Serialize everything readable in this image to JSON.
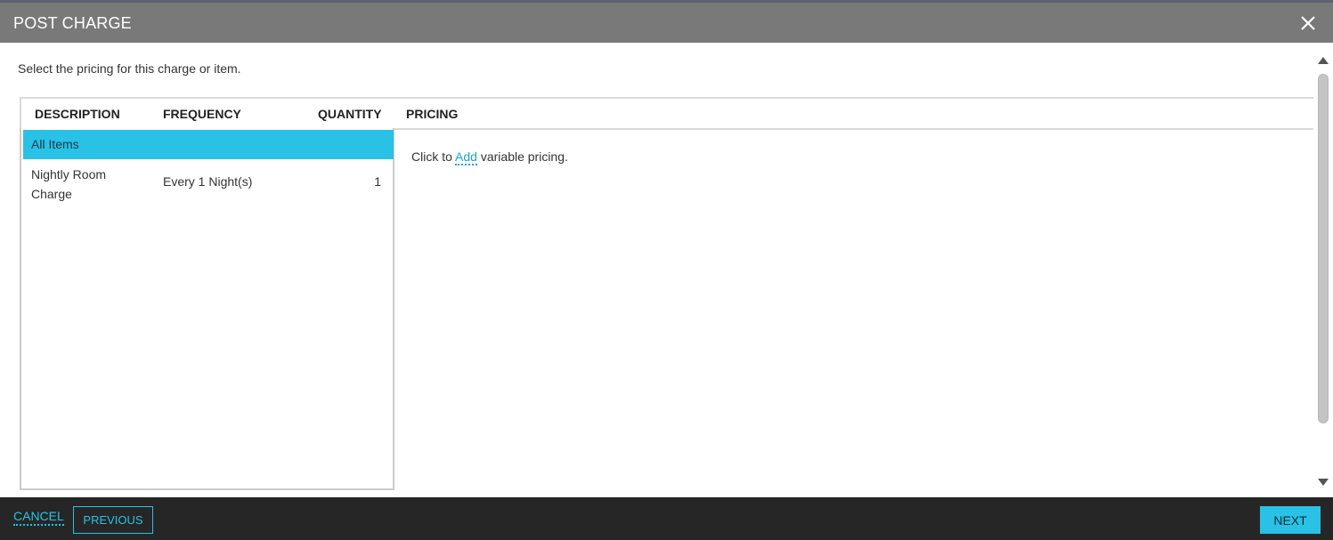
{
  "dialog": {
    "title": "POST CHARGE",
    "instruction": "Select the pricing for this charge or item."
  },
  "table": {
    "columns": [
      "DESCRIPTION",
      "FREQUENCY",
      "QUANTITY",
      "PRICING"
    ],
    "selected_row": "All Items",
    "rows": [
      {
        "description": "Nightly Room Charge",
        "frequency": "Every 1 Night(s)",
        "quantity": "1"
      }
    ]
  },
  "pricing": {
    "prefix": "Click to",
    "link": "Add",
    "suffix": "variable pricing."
  },
  "footer": {
    "cancel_label": "CANCEL",
    "previous_label": "PREVIOUS",
    "next_label": "NEXT"
  },
  "colors": {
    "header_bg": "#797979",
    "accent": "#29c2e6",
    "footer_bg": "#262626"
  },
  "icons": {
    "close": "close-icon",
    "scroll_up": "scroll-up-arrow-icon",
    "scroll_down": "scroll-down-arrow-icon"
  }
}
